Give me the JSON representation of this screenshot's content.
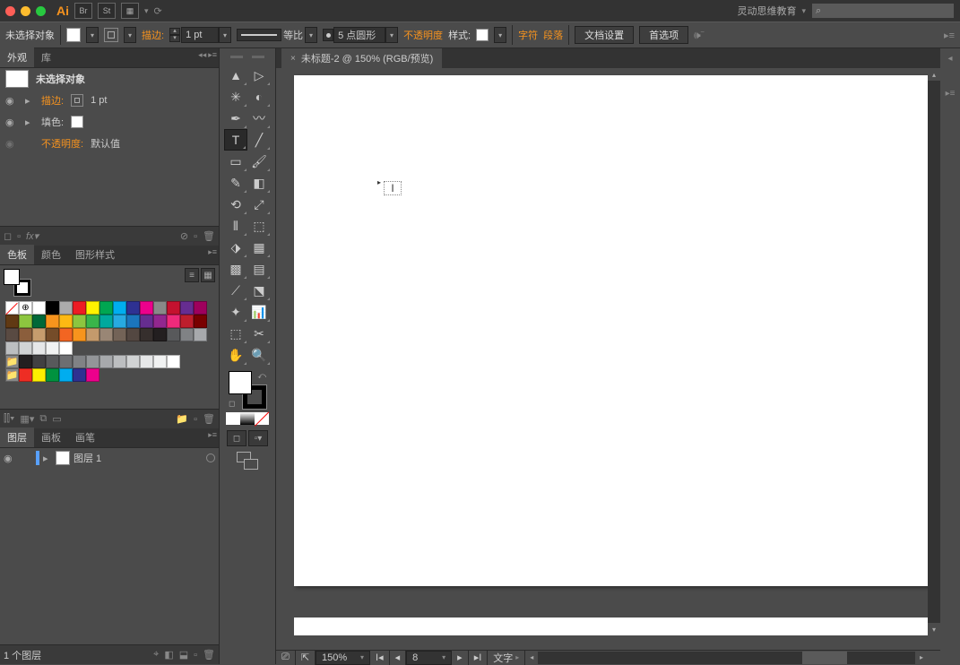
{
  "titlebar": {
    "workspace_label": "灵动思维教育",
    "search_placeholder": ""
  },
  "ctrlbar": {
    "no_selection": "未选择对象",
    "stroke_label": "描边:",
    "stroke_weight": "1 pt",
    "profile_label": "等比",
    "brush_label": "5 点圆形",
    "opacity_label": "不透明度",
    "style_label": "样式:",
    "char_label": "字符",
    "para_label": "段落",
    "doc_setup": "文档设置",
    "prefs": "首选项"
  },
  "appearance": {
    "tab_appearance": "外观",
    "tab_library": "库",
    "no_selection": "未选择对象",
    "stroke": "描边:",
    "stroke_value": "1 pt",
    "fill": "填色:",
    "opacity": "不透明度:",
    "opacity_value": "默认值"
  },
  "swatches": {
    "tab_swatches": "色板",
    "tab_color": "颜色",
    "tab_styles": "图形样式",
    "colors_row1": [
      "#ffffff",
      "#000000",
      "#acacac",
      "#ed1c24",
      "#fff200",
      "#00a651",
      "#00aeef",
      "#2e3192",
      "#ec008c",
      "#898989",
      "#c4122f",
      "#662d91",
      "#9e005d",
      "#603913",
      "#8dc63f",
      "#006838"
    ],
    "colors_row2": [
      "#f7941d",
      "#fdb913",
      "#8cc63f",
      "#39b54a",
      "#00a99d",
      "#27aae1",
      "#1b75bc",
      "#652d90",
      "#92278f",
      "#ee2a7b",
      "#be1e2d",
      "#790000",
      "#594a42",
      "#8b5e3c",
      "#c69c6d",
      "#754c29"
    ],
    "colors_row3": [
      "#f26522",
      "#f7941d",
      "#c49a6c",
      "#998675",
      "#736357",
      "#534741",
      "#362f2d",
      "#231f20",
      "#58595b",
      "#808285",
      "#a7a9ac",
      "#bcbec0",
      "#d1d3d4",
      "#e6e7e8",
      "#f1f2f2",
      "#ffffff"
    ],
    "colors_gray": [
      "#231f20",
      "#414042",
      "#58595b",
      "#6d6e71",
      "#808285",
      "#939598",
      "#a7a9ac",
      "#bcbec0",
      "#d1d3d4",
      "#e6e7e8",
      "#f1f2f2",
      "#ffffff"
    ],
    "colors_simple": [
      "#ee2d24",
      "#fdee00",
      "#00923f",
      "#00adef",
      "#2e3192",
      "#ed008c"
    ]
  },
  "layers": {
    "tab_layers": "图层",
    "tab_artboards": "画板",
    "tab_brushes": "画笔",
    "layer1_name": "图层 1",
    "count_label": "1 个图层"
  },
  "canvas": {
    "doc_tab": "未标题-2 @ 150% (RGB/预览)",
    "zoom": "150%",
    "artboard_num": "8",
    "status_mode": "文字"
  },
  "tools": {
    "names": [
      "selection",
      "direct-selection",
      "magic-wand",
      "lasso",
      "pen",
      "curvature",
      "type",
      "line",
      "rectangle",
      "paintbrush",
      "pencil",
      "eraser",
      "rotate",
      "scale",
      "width",
      "free-transform",
      "shape-builder",
      "perspective",
      "mesh",
      "gradient",
      "eyedropper",
      "blend",
      "symbol-sprayer",
      "column-graph",
      "artboard",
      "slice",
      "hand",
      "zoom"
    ]
  }
}
